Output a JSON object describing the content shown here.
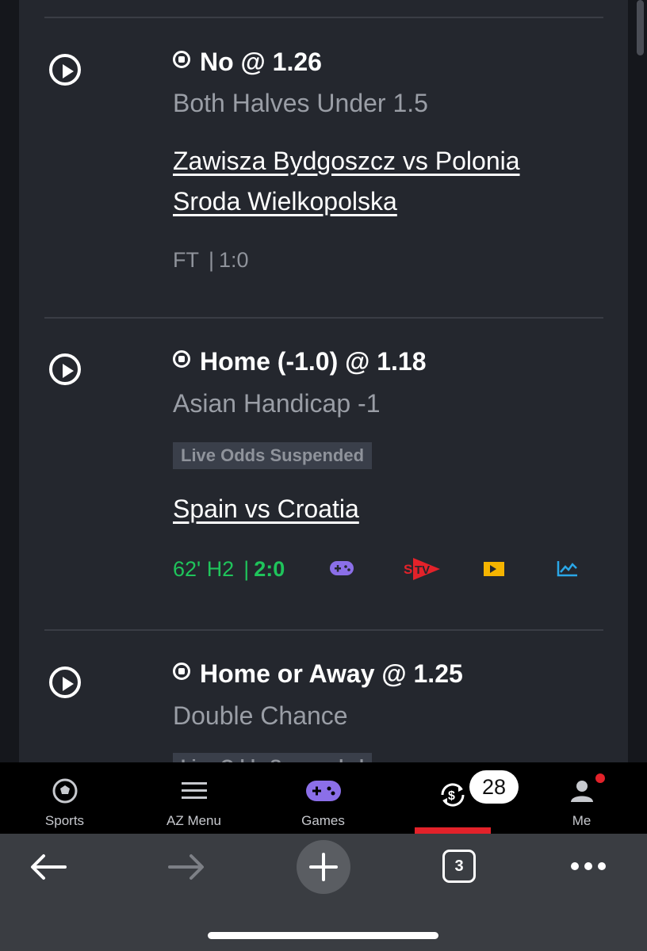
{
  "bets": [
    {
      "pick": "No @ 1.26",
      "market": "Both Halves Under 1.5",
      "badge": "",
      "match": "Zawisza Bydgoszcz vs Polonia Sroda Wielkopolska",
      "status": "FT",
      "score": "1:0",
      "live": false
    },
    {
      "pick": "Home (-1.0) @ 1.18",
      "market": "Asian Handicap -1",
      "badge": "Live Odds Suspended",
      "match": "Spain vs Croatia",
      "status": "62' H2",
      "score": "2:0",
      "live": true,
      "live_icons": [
        "game-controller-icon",
        "stv-icon",
        "play-tv-icon",
        "stats-chart-icon"
      ]
    },
    {
      "pick": "Home or Away @ 1.25",
      "market": "Double Chance",
      "badge": "Live Odds Suspended",
      "match": "",
      "status": "",
      "score": "",
      "live": true
    }
  ],
  "separator": "|",
  "nav": {
    "items": [
      {
        "label": "Sports",
        "icon": "soccer-ball-icon"
      },
      {
        "label": "AZ Menu",
        "icon": "hamburger-menu-icon"
      },
      {
        "label": "Games",
        "icon": "game-controller-icon"
      },
      {
        "label": "",
        "icon": "cashout-icon",
        "badge": "28",
        "active": true
      },
      {
        "label": "Me",
        "icon": "user-icon",
        "notification": true
      }
    ]
  },
  "browser": {
    "tab_count": "3"
  },
  "colors": {
    "panel": "#24272e",
    "live_green": "#1fc45b",
    "accent_red": "#e3222a",
    "games_purple": "#8b6fe8",
    "tv_yellow": "#f5b400",
    "stats_blue": "#2aa7e8"
  }
}
